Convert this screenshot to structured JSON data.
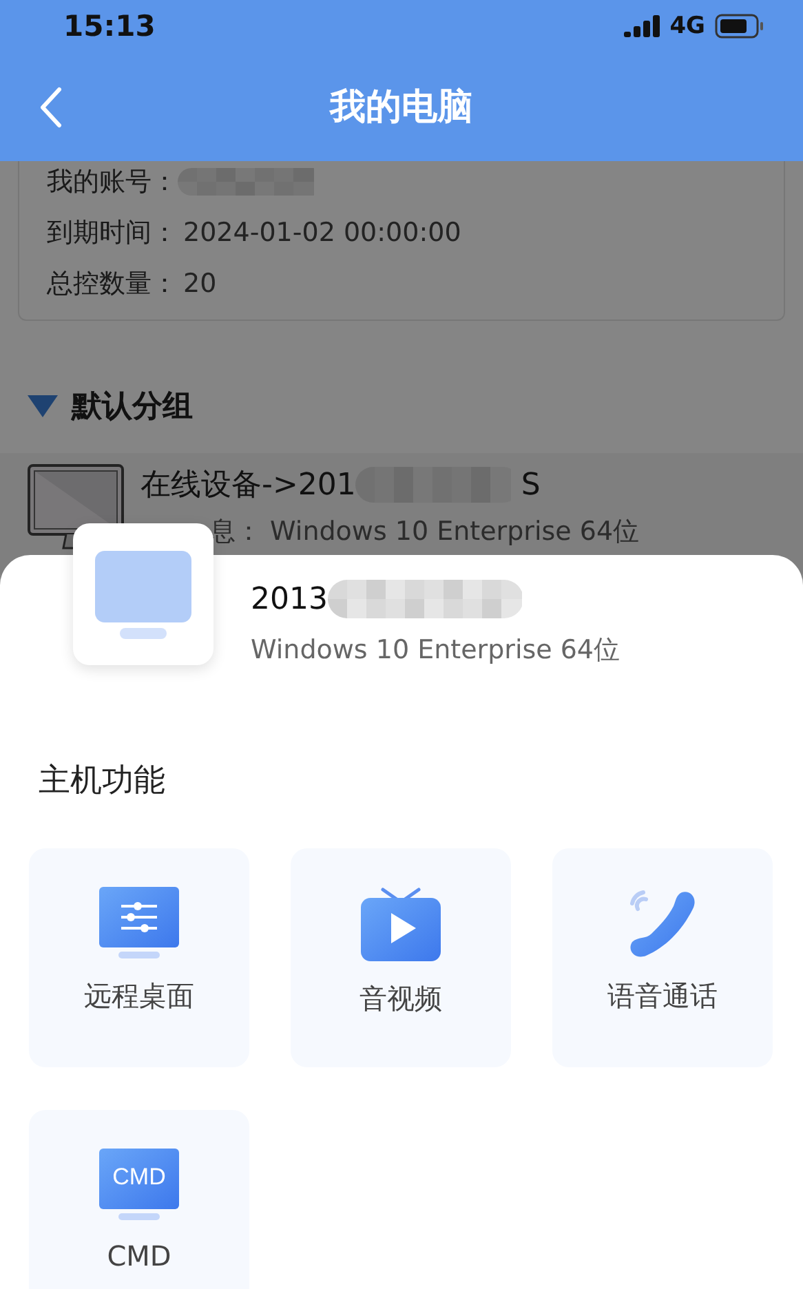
{
  "status_bar": {
    "time": "15:13",
    "network": "4G"
  },
  "header": {
    "title": "我的电脑"
  },
  "account": {
    "rows": [
      {
        "label": "我的账号：",
        "redacted": true
      },
      {
        "label": "到期时间：",
        "value": "2024-01-02 00:00:00",
        "redacted": false
      },
      {
        "label": "总控数量：",
        "value": "20",
        "redacted": false
      }
    ]
  },
  "group": {
    "name": "默认分组",
    "expanded": true
  },
  "device": {
    "name_start": "在线设备->201",
    "name_end": "S",
    "info": "息： Windows 10 Enterprise 64位"
  },
  "sheet": {
    "device_name": "2013",
    "os": "Windows 10 Enterprise 64位",
    "section_title": "主机功能",
    "functions": [
      {
        "kind": "remote-desktop",
        "label": "远程桌面"
      },
      {
        "kind": "video",
        "label": "音视频"
      },
      {
        "kind": "voice-call",
        "label": "语音通话"
      },
      {
        "kind": "cmd",
        "label": "CMD",
        "icon_text": "CMD"
      }
    ]
  }
}
